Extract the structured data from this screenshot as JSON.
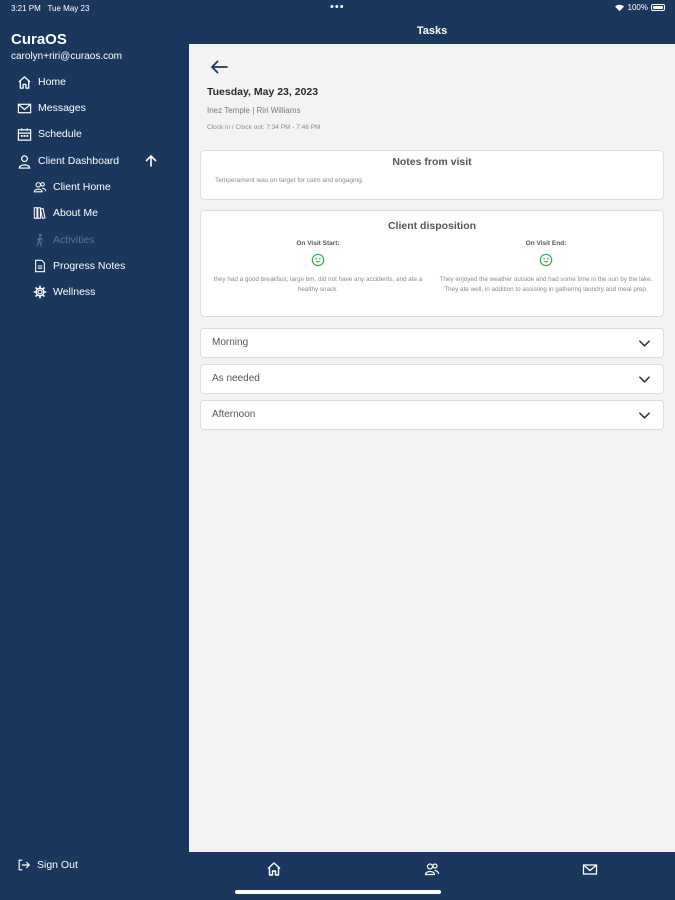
{
  "status_bar": {
    "time": "3:21 PM",
    "date": "Tue May 23",
    "dots": "•••",
    "battery": "100%"
  },
  "app": {
    "title": "CuraOS",
    "user_email": "carolyn+riri@curaos.com"
  },
  "sidebar": {
    "items": [
      {
        "label": "Home",
        "icon": "home-icon"
      },
      {
        "label": "Messages",
        "icon": "mail-icon"
      },
      {
        "label": "Schedule",
        "icon": "calendar-icon"
      },
      {
        "label": "Client Dashboard",
        "icon": "person-icon"
      }
    ],
    "sub_items": [
      {
        "label": "Client Home",
        "icon": "people-icon"
      },
      {
        "label": "About Me",
        "icon": "book-icon"
      },
      {
        "label": "Activities",
        "icon": "activity-icon",
        "disabled": true
      },
      {
        "label": "Progress Notes",
        "icon": "document-icon"
      },
      {
        "label": "Wellness",
        "icon": "gear-icon"
      }
    ],
    "sign_out": "Sign Out"
  },
  "header": {
    "title": "Tasks"
  },
  "visit": {
    "date": "Tuesday, May 23, 2023",
    "names": "Inez Temple | Riri Williams",
    "clock": "Clock in / Clock out: 7:34 PM - 7:46 PM"
  },
  "notes": {
    "title": "Notes from visit",
    "text": "Temperament was on target for calm and engaging."
  },
  "disposition": {
    "title": "Client disposition",
    "start_label": "On Visit Start:",
    "start_text": "they had a good breakfast, large bm, did not have any accidents, and ate a healthy snack.",
    "end_label": "On Visit End:",
    "end_text": "They enjoyed the weather outside and had some time in the sun by the lake. They ate well, in addition to assisting in gathering laundry and meal prep."
  },
  "sections": [
    {
      "label": "Morning"
    },
    {
      "label": "As needed"
    },
    {
      "label": "Afternoon"
    }
  ],
  "colors": {
    "navy": "#1b375e",
    "content_bg": "#f3f3f3",
    "smiley_green": "#2aa84a"
  }
}
